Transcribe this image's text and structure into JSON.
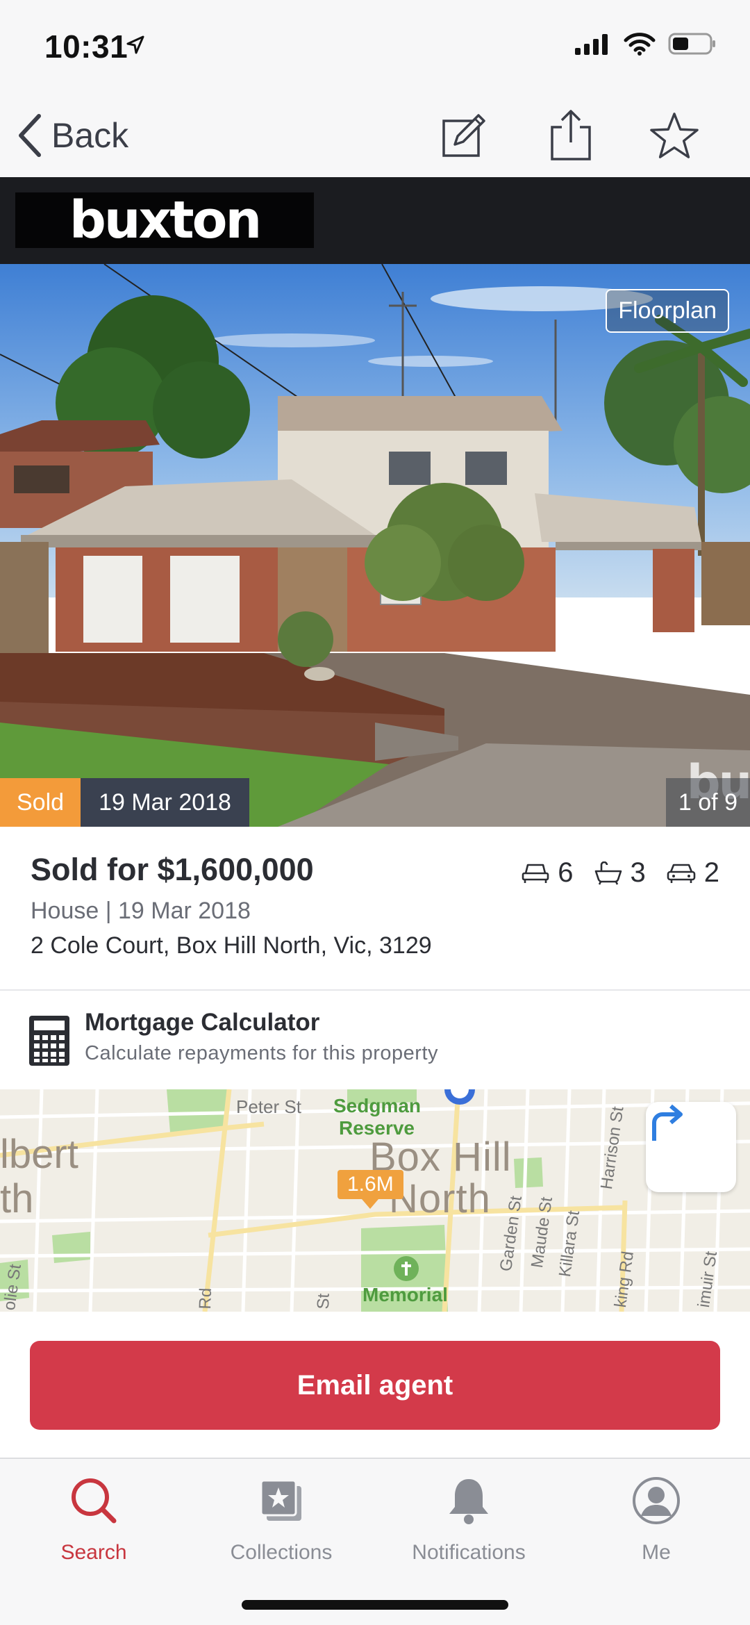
{
  "status_bar": {
    "time": "10:31"
  },
  "nav": {
    "back_label": "Back",
    "icons": [
      "edit-icon",
      "share-icon",
      "star-icon"
    ]
  },
  "agency": {
    "logo_text": "buxton",
    "background": "#1b1c20"
  },
  "hero": {
    "floorplan_label": "Floorplan",
    "status_badge": "Sold",
    "sold_date": "19 Mar 2018",
    "photo_counter": "1 of 9",
    "watermark": "bu",
    "status_color": "#f39b3a"
  },
  "summary": {
    "price": "Sold for $1,600,000",
    "subline": "House | 19 Mar 2018",
    "address": "2 Cole Court, Box Hill North, Vic, 3129",
    "bedrooms": "6",
    "bathrooms": "3",
    "parking": "2"
  },
  "mortgage": {
    "title": "Mortgage Calculator",
    "subtitle": "Calculate repayments for this property"
  },
  "map": {
    "price_pin": "1.6M",
    "labels": {
      "peter_st": "Peter St",
      "sedgman_1": "Sedgman",
      "sedgman_2": "Reserve",
      "suburb_1": "Box Hill",
      "suburb_2": "North",
      "albert": "lbert",
      "th": "th",
      "memorial": "Memorial",
      "garden_st": "Garden St",
      "maude_st": "Maude St",
      "killara_st": "Killara St",
      "harrison_st": "Harrison St",
      "king_rd": "king Rd",
      "muir_st": "imuir St",
      "rd": "Rd",
      "st": "St",
      "lie_st": "olie St"
    }
  },
  "cta": {
    "email_label": "Email agent",
    "color": "#d33a4a"
  },
  "tabs": [
    {
      "label": "Search",
      "icon": "search-icon",
      "active": true
    },
    {
      "label": "Collections",
      "icon": "collections-icon",
      "active": false
    },
    {
      "label": "Notifications",
      "icon": "bell-icon",
      "active": false
    },
    {
      "label": "Me",
      "icon": "user-icon",
      "active": false
    }
  ]
}
